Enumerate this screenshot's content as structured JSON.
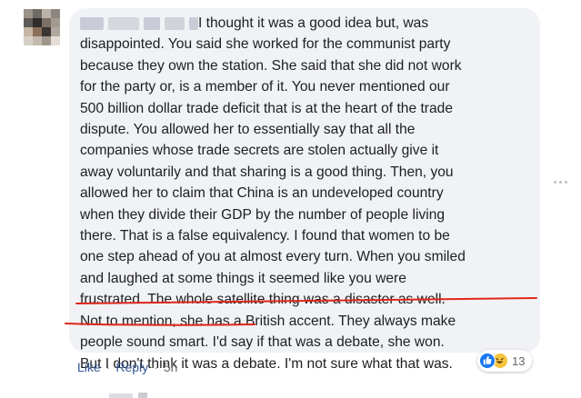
{
  "comment": {
    "text_line1": "I thought it was a good idea but, was",
    "text_body": "disappointed. You said she worked for the communist party\nbecause they own the station. She said that she did not work\nfor the party or, is a member of it. You never mentioned our\n500 billion dollar trade deficit that is at the heart of the trade\ndispute. You allowed her to essentially say that all the\ncompanies whose trade secrets are stolen actually give it\naway voluntarily and that sharing is a good thing. Then, you\nallowed her to claim that China is an undeveloped country\nwhen they divide their GDP by the number of people living\nthere. That is a false equivalency. I found that women to be\none step ahead of you at almost every turn. When you smiled\nand laughed at some things it seemed like you were\nfrustrated. The whole satellite thing was a disaster as well.\nNot to mention, she has a British accent. They always make\npeople sound smart. I'd say if that was a debate, she won.\nBut I don't think it was a debate. I'm not sure what that was."
  },
  "actions": {
    "like": "Like",
    "separator": "·",
    "reply": "Reply",
    "time": "5h"
  },
  "reactions": {
    "count": "13",
    "icons": [
      "like-icon",
      "haha-icon"
    ]
  },
  "colors": {
    "bubble": "#f0f2f5",
    "link": "#385898",
    "underline": "#e0261d",
    "like_blue": "#1877f2",
    "haha_yellow": "#f7c33f"
  }
}
